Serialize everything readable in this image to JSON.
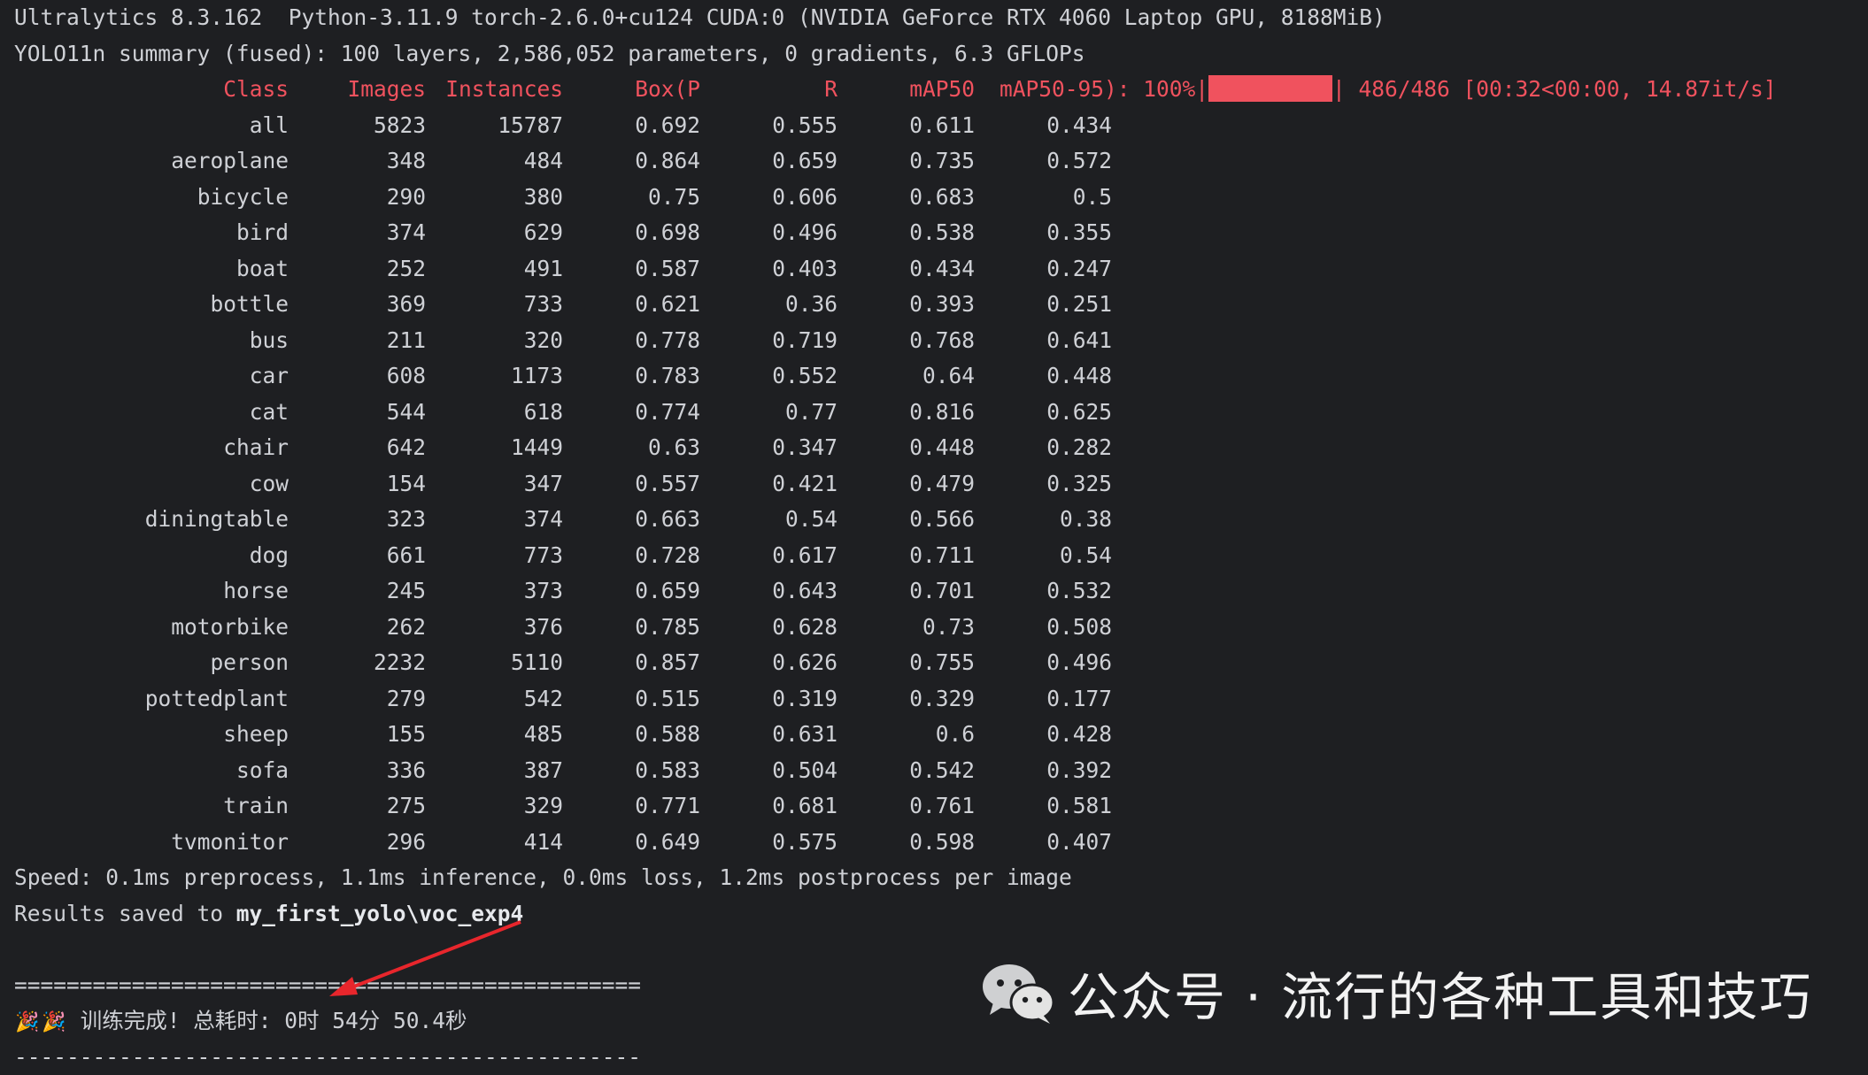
{
  "terminal": {
    "lines": {
      "env": "Ultralytics 8.3.162  Python-3.11.9 torch-2.6.0+cu124 CUDA:0 (NVIDIA GeForce RTX 4060 Laptop GPU, 8188MiB)",
      "summary": "YOLO11n summary (fused): 100 layers, 2,586,052 parameters, 0 gradients, 6.3 GFLOPs",
      "speed": "Speed: 0.1ms preprocess, 1.1ms inference, 0.0ms loss, 1.2ms postprocess per image",
      "results_prefix": "Results saved to ",
      "results_path": "my_first_yolo\\voc_exp4",
      "separator": "================================================",
      "done_text": "训练完成! 总耗时: 0时 54分 50.4秒",
      "separator_bottom": "------------------------------------------------"
    },
    "colors": {
      "accent_red": "#f0525e",
      "background": "#1e1f22",
      "text": "#cfd1d6"
    },
    "progress": {
      "suffix_head": "mAP50-95): 100%|",
      "fill_fraction": 1.0,
      "suffix_tail": "| 486/486 [00:32<00:00, 14.87it/s]"
    },
    "table": {
      "headers": [
        "Class",
        "Images",
        "Instances",
        "Box(P",
        "R",
        "mAP50"
      ],
      "rows": [
        [
          "all",
          "5823",
          "15787",
          "0.692",
          "0.555",
          "0.611",
          "0.434"
        ],
        [
          "aeroplane",
          "348",
          "484",
          "0.864",
          "0.659",
          "0.735",
          "0.572"
        ],
        [
          "bicycle",
          "290",
          "380",
          "0.75",
          "0.606",
          "0.683",
          "0.5"
        ],
        [
          "bird",
          "374",
          "629",
          "0.698",
          "0.496",
          "0.538",
          "0.355"
        ],
        [
          "boat",
          "252",
          "491",
          "0.587",
          "0.403",
          "0.434",
          "0.247"
        ],
        [
          "bottle",
          "369",
          "733",
          "0.621",
          "0.36",
          "0.393",
          "0.251"
        ],
        [
          "bus",
          "211",
          "320",
          "0.778",
          "0.719",
          "0.768",
          "0.641"
        ],
        [
          "car",
          "608",
          "1173",
          "0.783",
          "0.552",
          "0.64",
          "0.448"
        ],
        [
          "cat",
          "544",
          "618",
          "0.774",
          "0.77",
          "0.816",
          "0.625"
        ],
        [
          "chair",
          "642",
          "1449",
          "0.63",
          "0.347",
          "0.448",
          "0.282"
        ],
        [
          "cow",
          "154",
          "347",
          "0.557",
          "0.421",
          "0.479",
          "0.325"
        ],
        [
          "diningtable",
          "323",
          "374",
          "0.663",
          "0.54",
          "0.566",
          "0.38"
        ],
        [
          "dog",
          "661",
          "773",
          "0.728",
          "0.617",
          "0.711",
          "0.54"
        ],
        [
          "horse",
          "245",
          "373",
          "0.659",
          "0.643",
          "0.701",
          "0.532"
        ],
        [
          "motorbike",
          "262",
          "376",
          "0.785",
          "0.628",
          "0.73",
          "0.508"
        ],
        [
          "person",
          "2232",
          "5110",
          "0.857",
          "0.626",
          "0.755",
          "0.496"
        ],
        [
          "pottedplant",
          "279",
          "542",
          "0.515",
          "0.319",
          "0.329",
          "0.177"
        ],
        [
          "sheep",
          "155",
          "485",
          "0.588",
          "0.631",
          "0.6",
          "0.428"
        ],
        [
          "sofa",
          "336",
          "387",
          "0.583",
          "0.504",
          "0.542",
          "0.392"
        ],
        [
          "train",
          "275",
          "329",
          "0.771",
          "0.681",
          "0.761",
          "0.581"
        ],
        [
          "tvmonitor",
          "296",
          "414",
          "0.649",
          "0.575",
          "0.598",
          "0.407"
        ]
      ]
    }
  },
  "icons": {
    "party": "party-popper-icon",
    "wechat": "wechat-logo"
  },
  "watermark": {
    "text": "公众号 · 流行的各种工具和技巧"
  }
}
